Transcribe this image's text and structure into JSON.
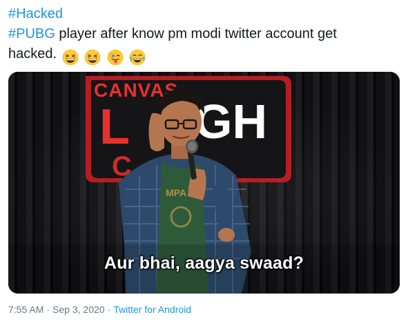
{
  "tweet": {
    "line1": {
      "hashtag": "#Hacked"
    },
    "line2": {
      "hashtag": "#PUBG",
      "text": " player after know pm modi twitter account get"
    },
    "line3": {
      "text": "hacked."
    },
    "emojis": [
      "grinning-squinting-face",
      "grinning-squinting-face",
      "winking-face-with-tongue",
      "face-with-tears-of-joy"
    ]
  },
  "media": {
    "sign_text": "CANVAS",
    "sign_big_text": "LAUGH",
    "subtitle": "Aur bhai, aagya swaad?"
  },
  "meta": {
    "time": "7:55 AM",
    "separator": "·",
    "date": "Sep 3, 2020",
    "separator2": "·",
    "source": "Twitter for Android"
  },
  "colors": {
    "hashtag": "#1b95e0",
    "text": "#14171a",
    "meta": "#657786",
    "sign_red": "#e8312f"
  }
}
